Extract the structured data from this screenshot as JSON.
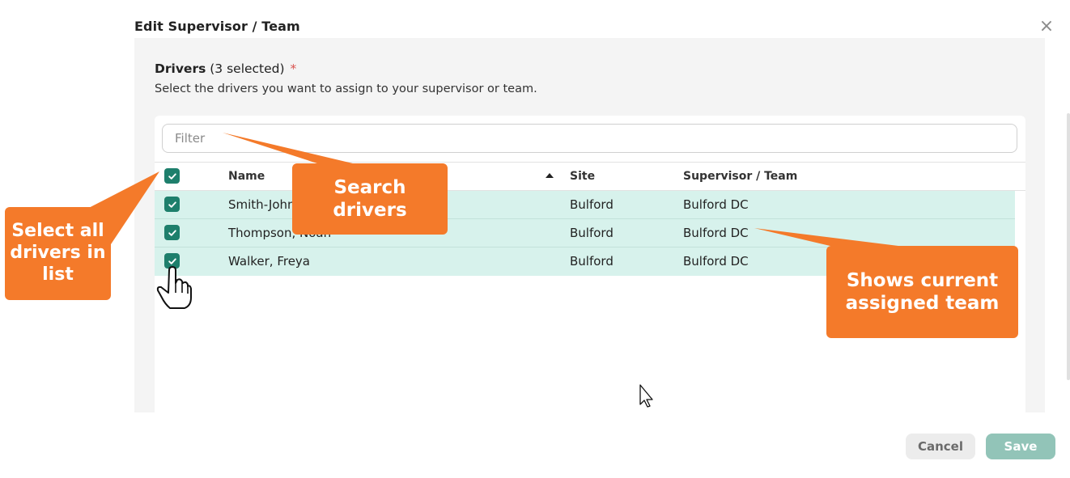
{
  "dialog": {
    "title": "Edit Supervisor / Team",
    "close_glyph": "×"
  },
  "field": {
    "label": "Drivers",
    "selected_text": "(3 selected)",
    "required_marker": "*",
    "description": "Select the drivers you want to assign to your supervisor or team."
  },
  "filter": {
    "placeholder": "Filter",
    "value": ""
  },
  "table": {
    "columns": {
      "name": "Name",
      "site": "Site",
      "team": "Supervisor / Team"
    },
    "sort": {
      "column": "name",
      "direction": "ascending"
    },
    "select_all_checked": true,
    "rows": [
      {
        "name": "Smith-John",
        "site": "Bulford",
        "team": "Bulford DC",
        "checked": true
      },
      {
        "name": "Thompson, Noah",
        "site": "Bulford",
        "team": "Bulford DC",
        "checked": true
      },
      {
        "name": "Walker, Freya",
        "site": "Bulford",
        "team": "Bulford DC",
        "checked": true
      }
    ]
  },
  "buttons": {
    "cancel": "Cancel",
    "save": "Save"
  },
  "callouts": {
    "select_all": [
      "Select all",
      "drivers in",
      "list"
    ],
    "search": [
      "Search",
      "drivers"
    ],
    "team": [
      "Shows current",
      "assigned team"
    ]
  },
  "colors": {
    "accent": "#1e7f6c",
    "row_selected": "#d7f2ec",
    "callout": "#f47a2a",
    "save_disabled": "#92c4b8"
  },
  "icons": {
    "checkbox": "checkmark-icon",
    "close": "close-icon",
    "pointer": "hand-pointer-icon",
    "cursor": "arrow-cursor-icon"
  }
}
